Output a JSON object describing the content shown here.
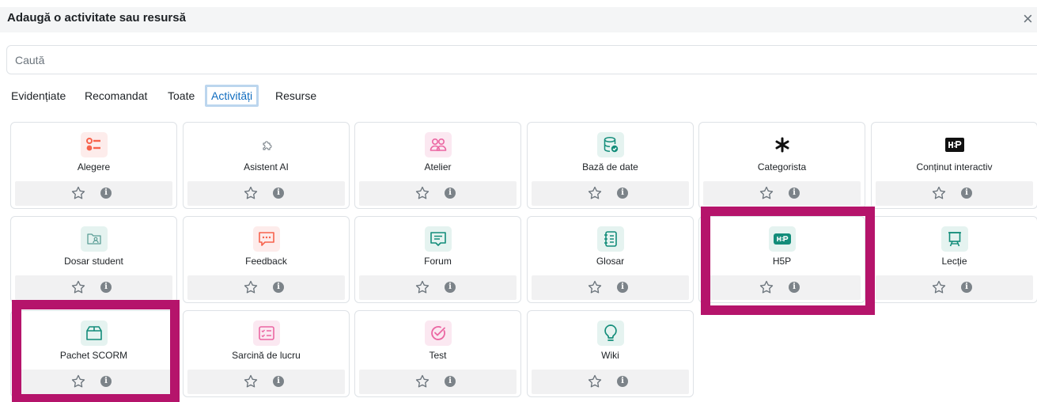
{
  "modal": {
    "title": "Adaugă o activitate sau resursă",
    "close_symbol": "×",
    "search_placeholder": "Caută"
  },
  "tabs": [
    {
      "label": "Evidențiate",
      "active": false
    },
    {
      "label": "Recomandat",
      "active": false
    },
    {
      "label": "Toate",
      "active": false
    },
    {
      "label": "Activități",
      "active": true
    },
    {
      "label": "Resurse",
      "active": false
    }
  ],
  "modules": [
    {
      "name": "Alegere",
      "icon": "choice-icon",
      "color": "#f7634d"
    },
    {
      "name": "Asistent AI",
      "icon": "puzzle-icon",
      "color": "#6a737b"
    },
    {
      "name": "Atelier",
      "icon": "people-icon",
      "color": "#eb66a2"
    },
    {
      "name": "Bază de date",
      "icon": "database-icon",
      "color": "#399be2"
    },
    {
      "name": "Categorista",
      "icon": "asterisk-icon",
      "color": "#111111"
    },
    {
      "name": "Conținut interactiv",
      "icon": "h5p-logo-icon",
      "color": "#111111"
    },
    {
      "name": "Dosar student",
      "icon": "student-folder-icon",
      "color": "#5b9e96"
    },
    {
      "name": "Feedback",
      "icon": "chat-bubble-icon",
      "color": "#f7634d"
    },
    {
      "name": "Forum",
      "icon": "forum-icon",
      "color": "#399be2"
    },
    {
      "name": "Glosar",
      "icon": "glossary-icon",
      "color": "#399be2"
    },
    {
      "name": "H5P",
      "icon": "h5p-icon",
      "color": "#399be2"
    },
    {
      "name": "Lecție",
      "icon": "lesson-easel-icon",
      "color": "#399be2"
    },
    {
      "name": "Pachet SCORM",
      "icon": "package-box-icon",
      "color": "#399be2"
    },
    {
      "name": "Sarcină de lucru",
      "icon": "assignment-icon",
      "color": "#eb66a2"
    },
    {
      "name": "Test",
      "icon": "quiz-check-icon",
      "color": "#eb66a2"
    },
    {
      "name": "Wiki",
      "icon": "lightbulb-icon",
      "color": "#399be2"
    }
  ],
  "highlight_color": "#b5146b"
}
